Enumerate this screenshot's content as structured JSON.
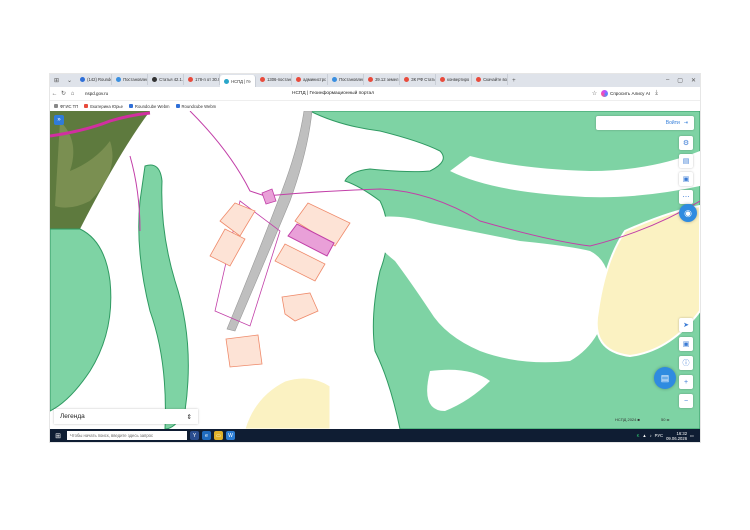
{
  "browser": {
    "tabs": [
      {
        "label": "(142) Roundc",
        "color": "#2f6fd8"
      },
      {
        "label": "Постановлен",
        "color": "#3a8fe0"
      },
      {
        "label": "Статья 42.1.",
        "color": "#333333"
      },
      {
        "label": "178-п от 30.0",
        "color": "#e84b3c"
      },
      {
        "label": "НСПД | Ге",
        "color": "#2aa6c9",
        "active": true
      },
      {
        "label": "1306-постан",
        "color": "#e84b3c"
      },
      {
        "label": "администрс",
        "color": "#e84b3c"
      },
      {
        "label": "Постановлен",
        "color": "#3a8fe0"
      },
      {
        "label": "39.12 земел",
        "color": "#e84b3c"
      },
      {
        "label": "ЗК РФ Стать",
        "color": "#e84b3c"
      },
      {
        "label": "конвертиро",
        "color": "#e84b3c"
      },
      {
        "label": "Скачайте во",
        "color": "#e84b3c"
      }
    ],
    "url": "nspd.gov.ru",
    "page_title": "НСПД | Геоинформационный портал",
    "alice_label": "Спросить Алису AI",
    "bookmarks": [
      "ФГИС ТП",
      "Екатерина Юрье",
      "Roundcube Webm",
      "Roundcube Webm"
    ]
  },
  "map": {
    "login_label": "Войти",
    "legend_label": "Легенда",
    "scale_label": "НСПД 2024 ■",
    "scale_value": "50 м"
  },
  "taskbar": {
    "search_placeholder": "Чтобы начать поиск, введите здесь запрос",
    "lang": "РУС",
    "time": "16:32",
    "date": "09.06.2026"
  },
  "colors": {
    "forest": "#7ed3a4",
    "forest_edge": "#2f9a62",
    "parcel_fill": "#fde3d6",
    "parcel_edge": "#ef8a6a",
    "parcel_selected": "#e9a0d8",
    "road": "#bfbfbf",
    "boundary": "#c23fa8",
    "field": "#fbf2c2",
    "accent": "#2f8be0"
  }
}
